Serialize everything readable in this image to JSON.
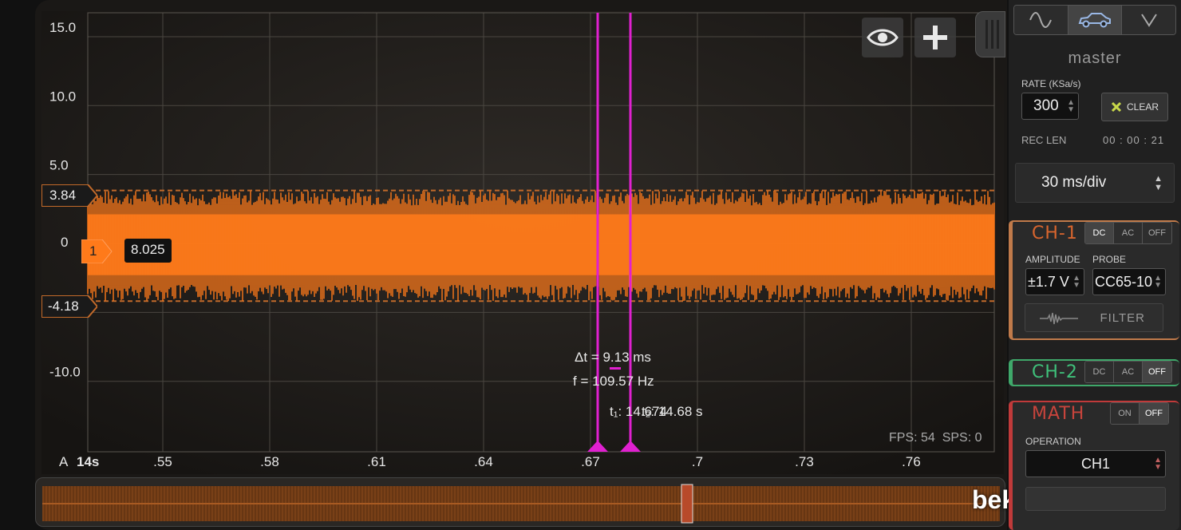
{
  "chart_data": {
    "type": "line",
    "series": [
      {
        "values": [],
        "y_min": -4.18,
        "y_max": 3.84
      }
    ],
    "y_tick_labels": [
      "15.0",
      "10.0",
      "5.0",
      "0",
      "-10.0"
    ],
    "x_axis_prefix": "A",
    "x_axis_start": "14s",
    "x_tick_labels": [
      ".55",
      ".58",
      ".61",
      ".64",
      ".67",
      ".7",
      ".73",
      ".76"
    ],
    "ylim": [
      -15,
      15
    ],
    "grid": true
  },
  "colors": {
    "trace": "#ff7a1a",
    "cursor": "#e020d0",
    "ch1": "#e07a3a",
    "ch2": "#3fa86a",
    "math": "#c03a3a"
  },
  "markers": {
    "upper_level": "3.84",
    "lower_level": "-4.18",
    "channel_number": "1",
    "channel_offset_value": "8.025"
  },
  "cursors": {
    "delta_t": "Δt = 9.13 ms",
    "frequency": "f = 109.57 Hz",
    "t1": "t₁: 14.674",
    "t2": "t₂: 14.68 s"
  },
  "status": {
    "fps": "FPS: 54",
    "sps": "SPS: 0"
  },
  "toolbar": {
    "view_icon": "eye-icon",
    "add_icon": "plus-icon"
  },
  "watermark": "bekomcar.com",
  "panel": {
    "modes": [
      "sine-wave-icon",
      "car-icon",
      "v-icon"
    ],
    "title": "master",
    "rate_label": "RATE (KSa/s)",
    "rate_value": "300",
    "clear_label": "CLEAR",
    "rec_len_label": "REC LEN",
    "rec_len_value": "00 : 00 : 21",
    "timebase": "30 ms/div",
    "ch1": {
      "title": "CH-1",
      "coupling": [
        "DC",
        "AC",
        "OFF"
      ],
      "coupling_selected": "DC",
      "amplitude_label": "AMPLITUDE",
      "amplitude_value": "±1.7 V",
      "probe_label": "PROBE",
      "probe_value": "CC65-10",
      "filter_label": "FILTER"
    },
    "ch2": {
      "title": "CH-2",
      "coupling": [
        "DC",
        "AC",
        "OFF"
      ],
      "coupling_selected": "OFF"
    },
    "math": {
      "title": "MATH",
      "toggle": [
        "ON",
        "OFF"
      ],
      "toggle_selected": "OFF",
      "operation_label": "OPERATION",
      "operation_value": "CH1"
    }
  }
}
